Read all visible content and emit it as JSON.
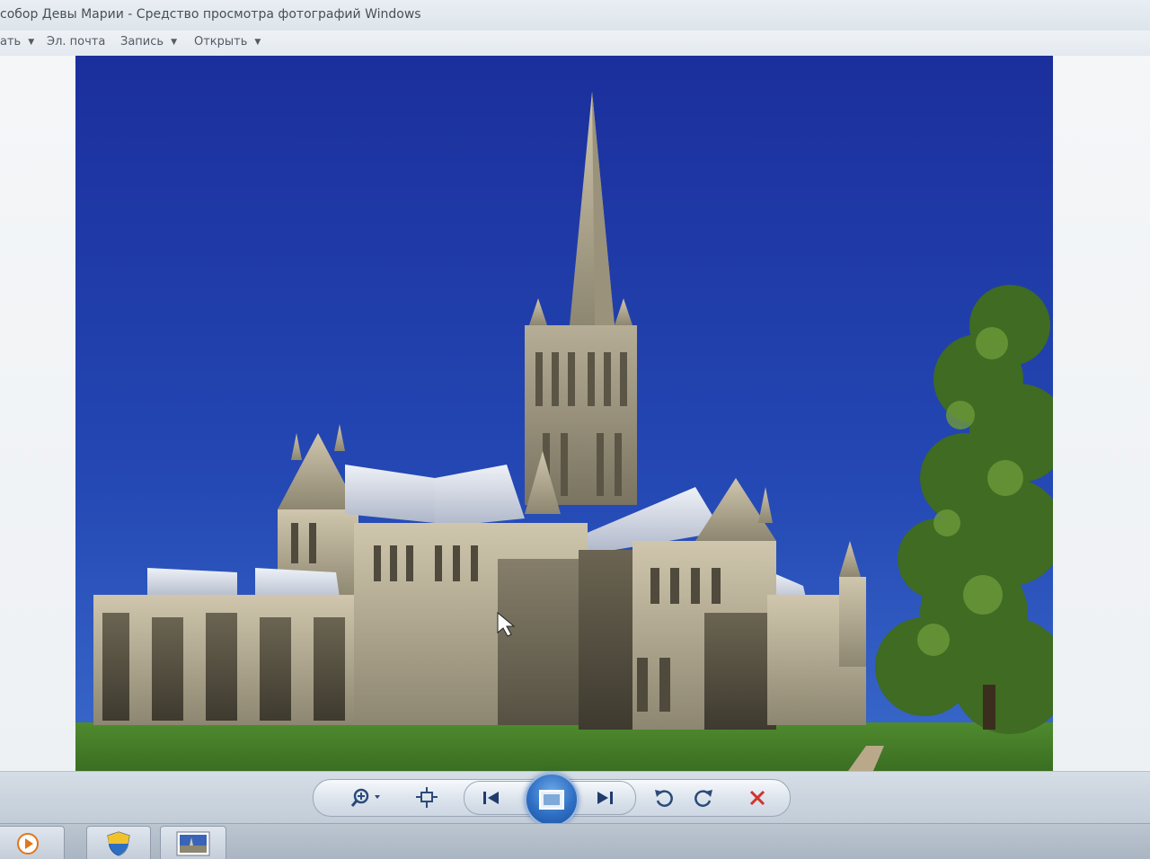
{
  "window": {
    "title": "собор Девы Марии - Средство просмотра фотографий Windows"
  },
  "menu": {
    "items": [
      {
        "label": "ать",
        "has_arrow": true
      },
      {
        "label": "Эл. почта",
        "has_arrow": false
      },
      {
        "label": "Запись",
        "has_arrow": true
      },
      {
        "label": "Открыть",
        "has_arrow": true
      }
    ]
  },
  "photo": {
    "subject": "cathedral-photo"
  },
  "controls": {
    "buttons": [
      {
        "name": "zoom-button",
        "icon": "magnifier-icon"
      },
      {
        "name": "actual-size-button",
        "icon": "fit-window-icon"
      },
      {
        "name": "previous-button",
        "icon": "previous-icon"
      },
      {
        "name": "slideshow-button",
        "icon": "slideshow-icon"
      },
      {
        "name": "next-button",
        "icon": "next-icon"
      },
      {
        "name": "rotate-left-button",
        "icon": "rotate-counterclockwise-icon"
      },
      {
        "name": "rotate-right-button",
        "icon": "rotate-clockwise-icon"
      },
      {
        "name": "delete-button",
        "icon": "delete-x-icon"
      }
    ]
  },
  "taskbar": {
    "items": [
      {
        "name": "media-player",
        "icon": "play-circle-icon"
      },
      {
        "name": "security-center",
        "icon": "shield-icon"
      },
      {
        "name": "photo-viewer",
        "icon": "photo-thumbnail-icon"
      }
    ]
  },
  "colors": {
    "sky": "#1f3ea8",
    "delete_red": "#d0342c",
    "accent_blue": "#2e6fc4"
  }
}
